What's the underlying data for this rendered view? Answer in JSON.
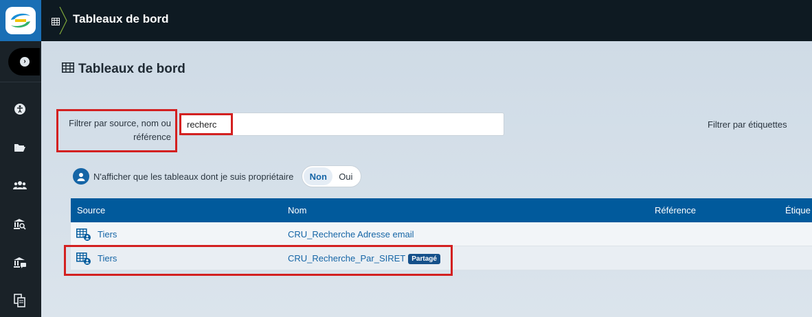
{
  "topbar": {
    "title": "Tableaux de bord"
  },
  "page": {
    "title": "Tableaux de bord"
  },
  "filters": {
    "source_label": "Filtrer par source, nom ou référence",
    "search_value": "recherc",
    "tags_label": "Filtrer par étiquettes"
  },
  "owner_filter": {
    "label": "N'afficher que les tableaux dont je suis propriétaire",
    "options": [
      "Non",
      "Oui"
    ],
    "selected": "Non"
  },
  "table": {
    "columns": [
      "Source",
      "Nom",
      "Référence",
      "Étique"
    ],
    "rows": [
      {
        "source": "Tiers",
        "nom": "CRU_Recherche Adresse email",
        "badge": ""
      },
      {
        "source": "Tiers",
        "nom": "CRU_Recherche_Par_SIRET",
        "badge": "Partagé"
      }
    ]
  },
  "sidebar": {
    "icons": [
      "accessibility-icon",
      "folder-open-icon",
      "users-icon",
      "bank-search-icon",
      "bank-chat-icon",
      "documents-icon"
    ]
  },
  "colors": {
    "accent": "#015a9c",
    "highlight": "#d32020",
    "topbar": "#0e1a22",
    "sidebar": "#1a2228"
  }
}
